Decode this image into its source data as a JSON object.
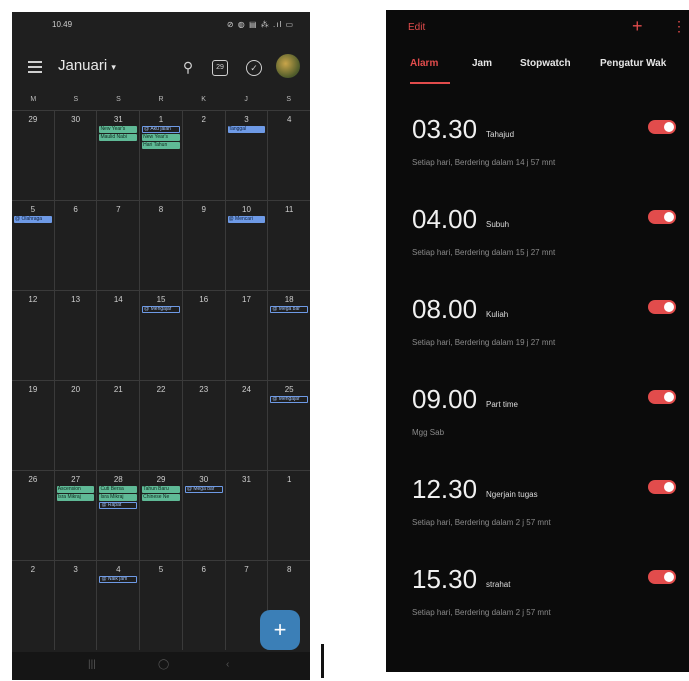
{
  "calendar": {
    "status_time": "10.49",
    "status_icons": "⊘ ◍ ▤ ⁂ .ıl ▭",
    "month": "Januari",
    "today_box": "29",
    "dow": [
      "M",
      "S",
      "S",
      "R",
      "K",
      "J",
      "S"
    ],
    "weeks": [
      {
        "days": [
          {
            "num": "29",
            "events": []
          },
          {
            "num": "30",
            "events": []
          },
          {
            "num": "31",
            "events": [
              {
                "t": "New Year's",
                "c": "g"
              },
              {
                "t": "Maulid Nabi",
                "c": "g"
              }
            ]
          },
          {
            "num": "1",
            "events": [
              {
                "t": "@ Aku jalan",
                "c": "o"
              },
              {
                "t": "New Year's",
                "c": "g"
              },
              {
                "t": "Hari Tahun",
                "c": "g"
              }
            ]
          },
          {
            "num": "2",
            "events": []
          },
          {
            "num": "3",
            "events": [
              {
                "t": "Tanggal",
                "c": "b"
              }
            ]
          },
          {
            "num": "4",
            "events": []
          }
        ]
      },
      {
        "days": [
          {
            "num": "5",
            "events": [
              {
                "t": "@ Olahraga",
                "c": "b"
              }
            ]
          },
          {
            "num": "6",
            "events": []
          },
          {
            "num": "7",
            "events": []
          },
          {
            "num": "8",
            "events": []
          },
          {
            "num": "9",
            "events": []
          },
          {
            "num": "10",
            "events": [
              {
                "t": "@ Mencari",
                "c": "b"
              }
            ]
          },
          {
            "num": "11",
            "events": []
          }
        ]
      },
      {
        "days": [
          {
            "num": "12",
            "events": []
          },
          {
            "num": "13",
            "events": []
          },
          {
            "num": "14",
            "events": []
          },
          {
            "num": "15",
            "events": [
              {
                "t": "@ Mengajar",
                "c": "o"
              }
            ]
          },
          {
            "num": "16",
            "events": []
          },
          {
            "num": "17",
            "events": []
          },
          {
            "num": "18",
            "events": [
              {
                "t": "@ Mega bar",
                "c": "o"
              }
            ]
          }
        ]
      },
      {
        "days": [
          {
            "num": "19",
            "events": []
          },
          {
            "num": "20",
            "events": []
          },
          {
            "num": "21",
            "events": []
          },
          {
            "num": "22",
            "events": []
          },
          {
            "num": "23",
            "events": []
          },
          {
            "num": "24",
            "events": []
          },
          {
            "num": "25",
            "events": [
              {
                "t": "@ Mengajar",
                "c": "o"
              }
            ]
          }
        ]
      },
      {
        "days": [
          {
            "num": "26",
            "events": []
          },
          {
            "num": "27",
            "events": [
              {
                "t": "Ascension",
                "c": "g"
              },
              {
                "t": "Isra Mikraj",
                "c": "g"
              }
            ]
          },
          {
            "num": "28",
            "events": [
              {
                "t": "Cuti Bersa",
                "c": "g"
              },
              {
                "t": "Isra Mikraj",
                "c": "g"
              },
              {
                "t": "@ Rapat",
                "c": "o"
              }
            ]
          },
          {
            "num": "29",
            "events": [
              {
                "t": "Tahun Baru",
                "c": "g"
              },
              {
                "t": "Chinese Ne",
                "c": "g"
              }
            ]
          },
          {
            "num": "30",
            "events": [
              {
                "t": "@ Mega bar",
                "c": "o"
              }
            ]
          },
          {
            "num": "31",
            "events": []
          },
          {
            "num": "1",
            "events": []
          }
        ]
      },
      {
        "days": [
          {
            "num": "2",
            "events": []
          },
          {
            "num": "3",
            "events": []
          },
          {
            "num": "4",
            "events": [
              {
                "t": "@ Naik jam",
                "c": "o"
              }
            ]
          },
          {
            "num": "5",
            "events": []
          },
          {
            "num": "6",
            "events": []
          },
          {
            "num": "7",
            "events": []
          },
          {
            "num": "8",
            "events": []
          }
        ]
      }
    ],
    "fab_label": "+",
    "nav": {
      "recent": "|||",
      "home": "◯",
      "back": "‹"
    }
  },
  "clock": {
    "edit_label": "Edit",
    "add_label": "+",
    "more_label": "⋮",
    "tabs": [
      {
        "label": "Alarm",
        "active": true
      },
      {
        "label": "Jam",
        "active": false
      },
      {
        "label": "Stopwatch",
        "active": false
      },
      {
        "label": "Pengatur Wak",
        "active": false
      }
    ],
    "alarms": [
      {
        "time": "03.30",
        "label": "Tahajud",
        "desc": "Setiap hari, Berdering dalam 14 j 57 mnt",
        "on": true
      },
      {
        "time": "04.00",
        "label": "Subuh",
        "desc": "Setiap hari, Berdering dalam 15 j 27 mnt",
        "on": true
      },
      {
        "time": "08.00",
        "label": "Kuliah",
        "desc": "Setiap hari, Berdering dalam 19 j 27 mnt",
        "on": true
      },
      {
        "time": "09.00",
        "label": "Part time",
        "desc": "Mgg Sab",
        "on": true
      },
      {
        "time": "12.30",
        "label": "Ngerjain tugas",
        "desc": "Setiap hari, Berdering dalam 2 j 57 mnt",
        "on": true
      },
      {
        "time": "15.30",
        "label": "strahat",
        "desc": "Setiap hari, Berdering dalam 2 j 57 mnt",
        "on": true
      }
    ],
    "colors": {
      "accent": "#e24c4c",
      "background": "#0b0b0b"
    }
  }
}
